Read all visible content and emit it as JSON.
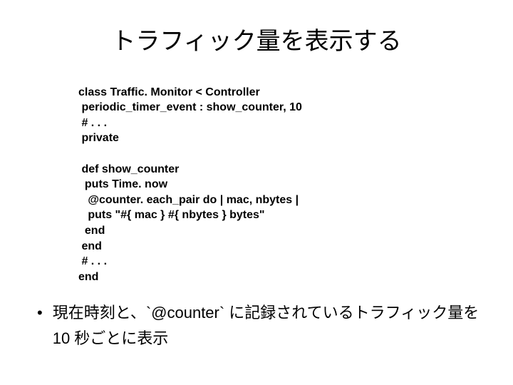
{
  "title": "トラフィック量を表示する",
  "code": {
    "l1": "class Traffic. Monitor < Controller",
    "l2": " periodic_timer_event : show_counter, 10",
    "l3": " # . . .",
    "l4": " private",
    "l5": "",
    "l6": " def show_counter",
    "l7": "  puts Time. now",
    "l8": "   @counter. each_pair do | mac, nbytes |",
    "l9": "   puts \"#{ mac } #{ nbytes } bytes\"",
    "l10": "  end",
    "l11": " end",
    "l12": " # . . .",
    "l13": "end"
  },
  "bullet": {
    "text": "現在時刻と、`@counter` に記録されているトラフィック量を 10 秒ごとに表示"
  }
}
